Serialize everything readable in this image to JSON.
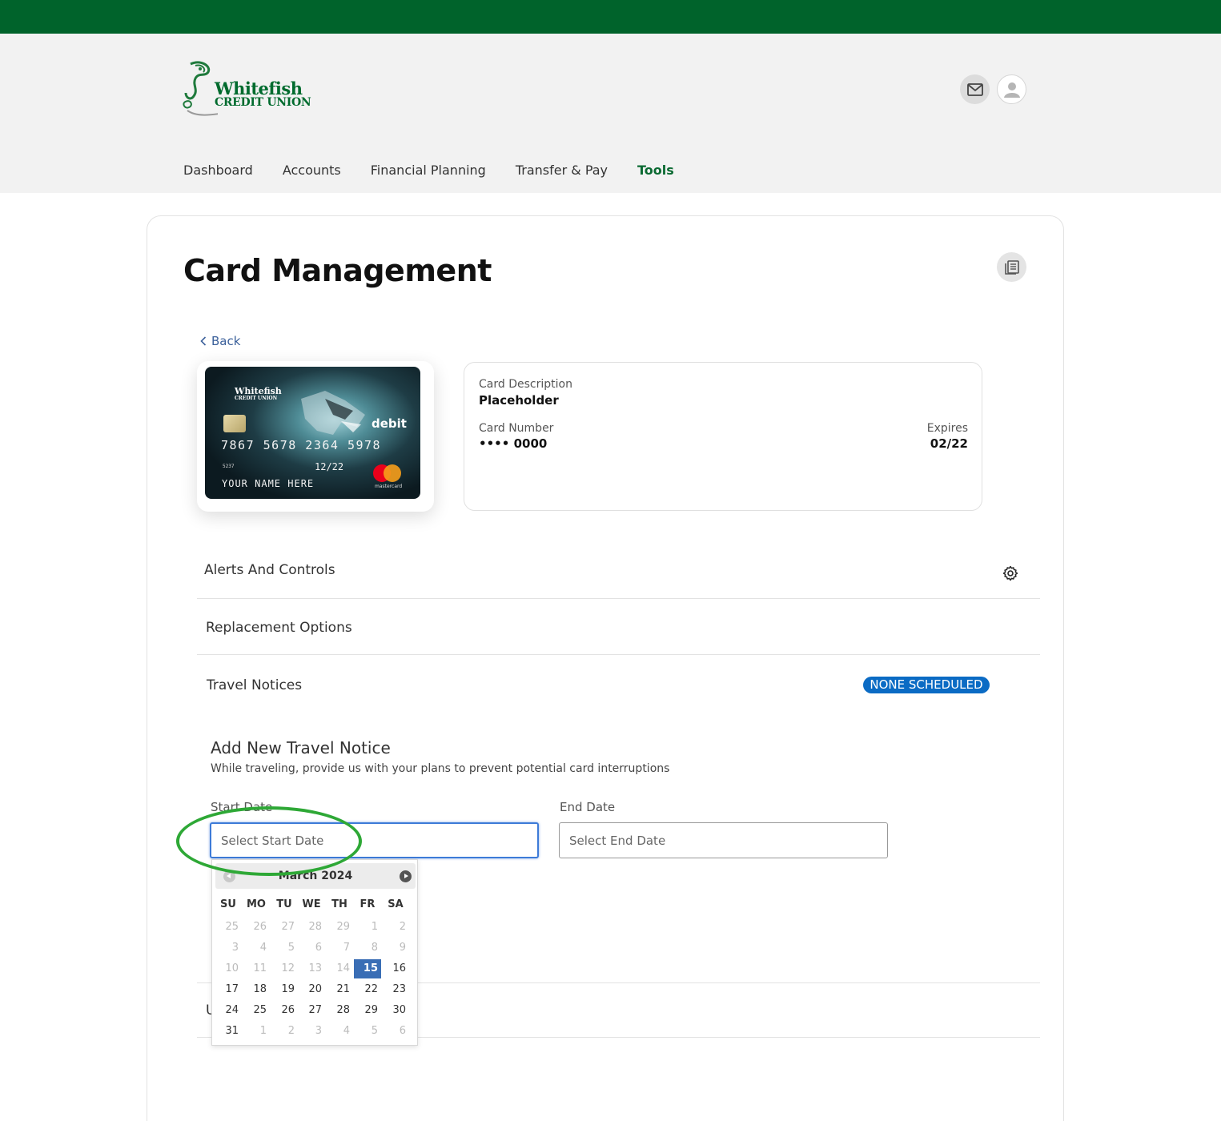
{
  "brand": {
    "name_line1": "Whitefish",
    "name_line2": "CREDIT UNION",
    "top_bar_color": "#00632b",
    "accent_color": "#0b6a32"
  },
  "header_icons": [
    "mail-icon",
    "user-icon"
  ],
  "nav": {
    "items": [
      {
        "label": "Dashboard",
        "active": false
      },
      {
        "label": "Accounts",
        "active": false
      },
      {
        "label": "Financial Planning",
        "active": false
      },
      {
        "label": "Transfer & Pay",
        "active": false
      },
      {
        "label": "Tools",
        "active": true
      }
    ]
  },
  "page": {
    "title": "Card Management",
    "back_label": "Back"
  },
  "card_image": {
    "brand_line1": "Whitefish",
    "brand_line2": "CREDIT UNION",
    "type": "debit",
    "number": "7867 5678 2364 5978",
    "small_number": "5237",
    "valid_thru_label": "VALID THRU",
    "expiry": "12/22",
    "holder": "YOUR NAME HERE",
    "network": "mastercard"
  },
  "card_info": {
    "description_label": "Card Description",
    "description_value": "Placeholder",
    "number_label": "Card Number",
    "number_value": "•••• 0000",
    "expires_label": "Expires",
    "expires_value": "02/22"
  },
  "sections": {
    "alerts": "Alerts And Controls",
    "replacement": "Replacement Options",
    "travel": "Travel Notices",
    "travel_badge": "NONE  SCHEDULED",
    "truncated_section_initial": "U"
  },
  "travel_notice": {
    "title": "Add New Travel Notice",
    "subtitle": "While traveling, provide us with your plans to prevent potential card interruptions",
    "start_label": "Start Date",
    "start_placeholder": "Select Start Date",
    "end_label": "End Date",
    "end_placeholder": "Select End Date"
  },
  "datepicker": {
    "month_label": "March 2024",
    "weekdays": [
      "SU",
      "MO",
      "TU",
      "WE",
      "TH",
      "FR",
      "SA"
    ],
    "weeks": [
      [
        {
          "d": "25",
          "dim": true
        },
        {
          "d": "26",
          "dim": true
        },
        {
          "d": "27",
          "dim": true
        },
        {
          "d": "28",
          "dim": true
        },
        {
          "d": "29",
          "dim": true
        },
        {
          "d": "1",
          "dim": true
        },
        {
          "d": "2",
          "dim": true
        }
      ],
      [
        {
          "d": "3",
          "dim": true
        },
        {
          "d": "4",
          "dim": true
        },
        {
          "d": "5",
          "dim": true
        },
        {
          "d": "6",
          "dim": true
        },
        {
          "d": "7",
          "dim": true
        },
        {
          "d": "8",
          "dim": true
        },
        {
          "d": "9",
          "dim": true
        }
      ],
      [
        {
          "d": "10",
          "dim": true
        },
        {
          "d": "11",
          "dim": true
        },
        {
          "d": "12",
          "dim": true
        },
        {
          "d": "13",
          "dim": true
        },
        {
          "d": "14",
          "dim": true
        },
        {
          "d": "15",
          "sel": true
        },
        {
          "d": "16"
        }
      ],
      [
        {
          "d": "17"
        },
        {
          "d": "18"
        },
        {
          "d": "19"
        },
        {
          "d": "20"
        },
        {
          "d": "21"
        },
        {
          "d": "22"
        },
        {
          "d": "23"
        }
      ],
      [
        {
          "d": "24"
        },
        {
          "d": "25"
        },
        {
          "d": "26"
        },
        {
          "d": "27"
        },
        {
          "d": "28"
        },
        {
          "d": "29"
        },
        {
          "d": "30"
        }
      ],
      [
        {
          "d": "31"
        },
        {
          "d": "1",
          "dim": true
        },
        {
          "d": "2",
          "dim": true
        },
        {
          "d": "3",
          "dim": true
        },
        {
          "d": "4",
          "dim": true
        },
        {
          "d": "5",
          "dim": true
        },
        {
          "d": "6",
          "dim": true
        }
      ]
    ],
    "selected_color": "#3a6eb5"
  },
  "annotation": {
    "shape": "ellipse",
    "color": "#2ea836",
    "target": "start-date-input"
  }
}
